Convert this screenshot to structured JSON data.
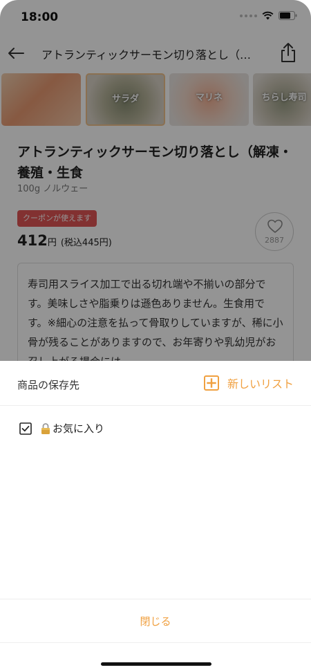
{
  "status_bar": {
    "time": "18:00"
  },
  "nav": {
    "title": "アトランティックサーモン切り落とし（…"
  },
  "thumbnails": [
    {
      "label": ""
    },
    {
      "label": "サラダ"
    },
    {
      "label": "マリネ"
    },
    {
      "label": "ちらし寿司"
    }
  ],
  "product": {
    "title": "アトランティックサーモン切り落とし（解凍・養殖・生食",
    "subtitle": "100g ノルウェー",
    "coupon_badge": "クーポンが使えます",
    "price": "412",
    "price_unit": "円",
    "price_tax": "(税込445円)",
    "favorite_count": "2887",
    "description": "寿司用スライス加工で出る切れ端や不揃いの部分です。美味しさや脂乗りは遜色ありません。生食用です。※細心の注意を払って骨取りしていますが、稀に小骨が残ることがありますので、お年寄りや乳幼児がお召し上がる場合には"
  },
  "sheet": {
    "title": "商品の保存先",
    "new_list_label": "新しいリスト",
    "lists": [
      {
        "label": "お気に入り",
        "checked": true,
        "locked": true
      }
    ],
    "close_label": "閉じる"
  },
  "colors": {
    "accent": "#f0a040",
    "coupon": "#e05555",
    "overlay": "rgba(0,0,0,0.42)"
  },
  "icons": [
    "back-arrow-icon",
    "share-icon",
    "heart-icon",
    "plus-square-icon",
    "checkbox-checked-icon",
    "lock-icon",
    "wifi-icon",
    "battery-icon"
  ]
}
